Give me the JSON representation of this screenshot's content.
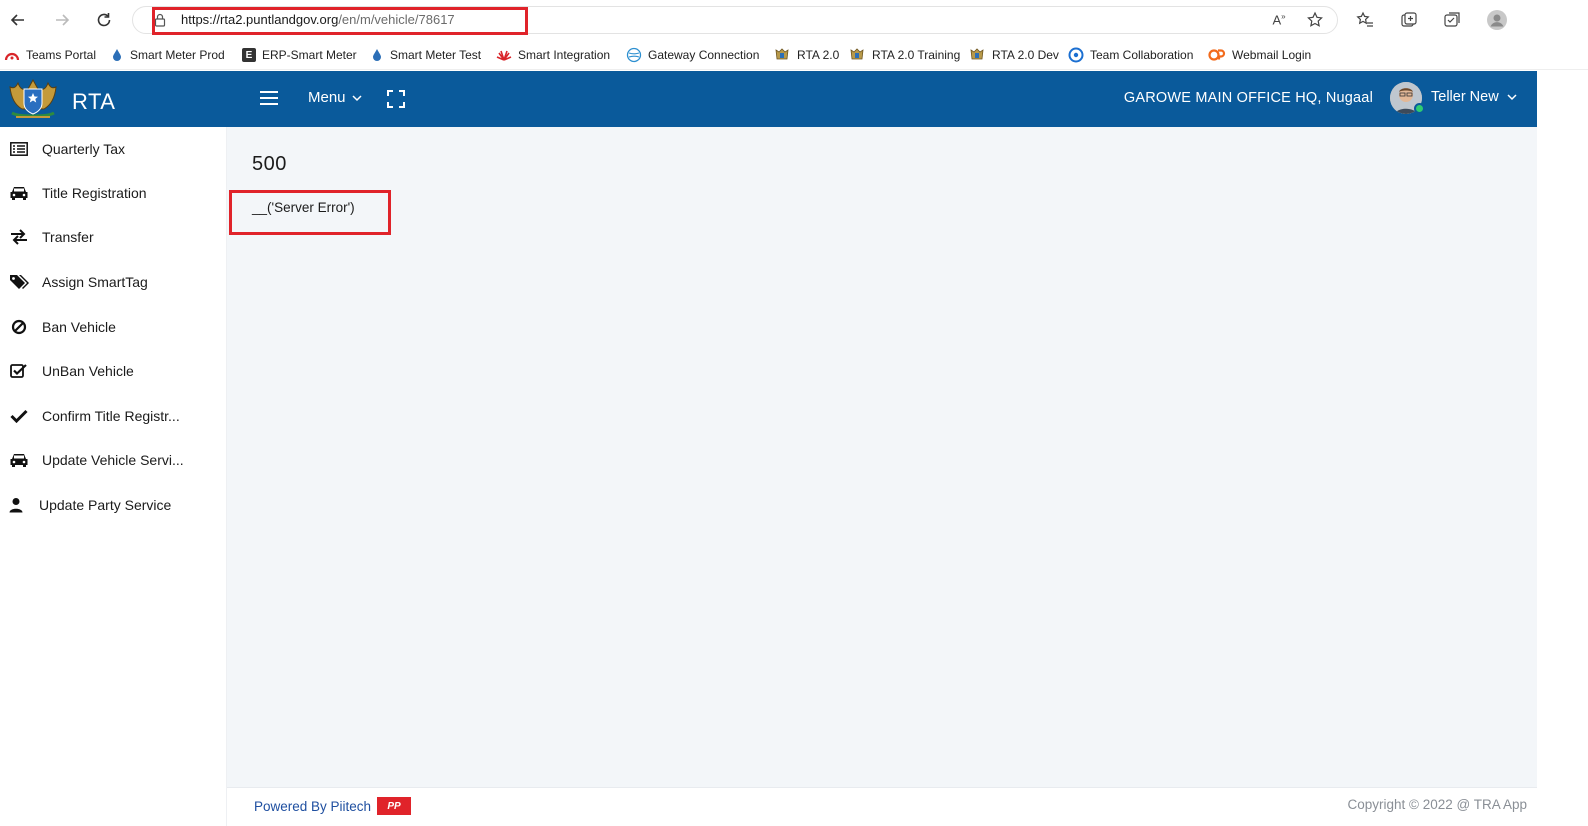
{
  "browser": {
    "url_host": "https://rta2.puntlandgov.org",
    "url_path": "/en/m/vehicle/78617",
    "bookmarks": [
      {
        "label": "Teams Portal",
        "icon": "teams-portal-icon",
        "color": "#d9252a"
      },
      {
        "label": "Smart Meter Prod",
        "icon": "drop-icon",
        "color": "#2c6fb7"
      },
      {
        "label": "ERP-Smart Meter",
        "icon": "letter-e-icon",
        "color": "#333333"
      },
      {
        "label": "Smart Meter Test",
        "icon": "drop-icon",
        "color": "#2c6fb7"
      },
      {
        "label": "Smart Integration",
        "icon": "huawei-icon",
        "color": "#d9252a"
      },
      {
        "label": "Gateway Connection",
        "icon": "globe-icon",
        "color": "#2c8fd0"
      },
      {
        "label": "RTA 2.0",
        "icon": "emblem-icon",
        "color": "#8a6d2f"
      },
      {
        "label": "RTA 2.0 Training",
        "icon": "emblem-icon",
        "color": "#8a6d2f"
      },
      {
        "label": "RTA 2.0 Dev",
        "icon": "emblem-icon",
        "color": "#8a6d2f"
      },
      {
        "label": "Team Collaboration",
        "icon": "collab-icon",
        "color": "#1b6fd1"
      },
      {
        "label": "Webmail Login",
        "icon": "cpanel-icon",
        "color": "#f26a1b"
      }
    ]
  },
  "header": {
    "brand": "RTA",
    "menu_label": "Menu",
    "office": "GAROWE MAIN OFFICE HQ, Nugaal",
    "user_name": "Teller New",
    "bg_color": "#0a5a9b"
  },
  "sidebar": {
    "items": [
      {
        "label": "Quarterly Tax",
        "icon": "list-icon"
      },
      {
        "label": "Title Registration",
        "icon": "car-icon"
      },
      {
        "label": "Transfer",
        "icon": "exchange-icon"
      },
      {
        "label": "Assign SmartTag",
        "icon": "tags-icon"
      },
      {
        "label": "Ban Vehicle",
        "icon": "ban-icon"
      },
      {
        "label": "UnBan Vehicle",
        "icon": "check-square-icon"
      },
      {
        "label": "Confirm Title Registr...",
        "icon": "check-icon"
      },
      {
        "label": "Update Vehicle Servi...",
        "icon": "car-icon"
      },
      {
        "label": "Update Party Service",
        "icon": "user-icon"
      }
    ]
  },
  "main": {
    "error_code": "500",
    "error_message": "__('Server Error')"
  },
  "footer": {
    "powered_by": "Powered By Piitech",
    "logo_text": "PP",
    "copyright": "Copyright © 2022 @ TRA App"
  }
}
